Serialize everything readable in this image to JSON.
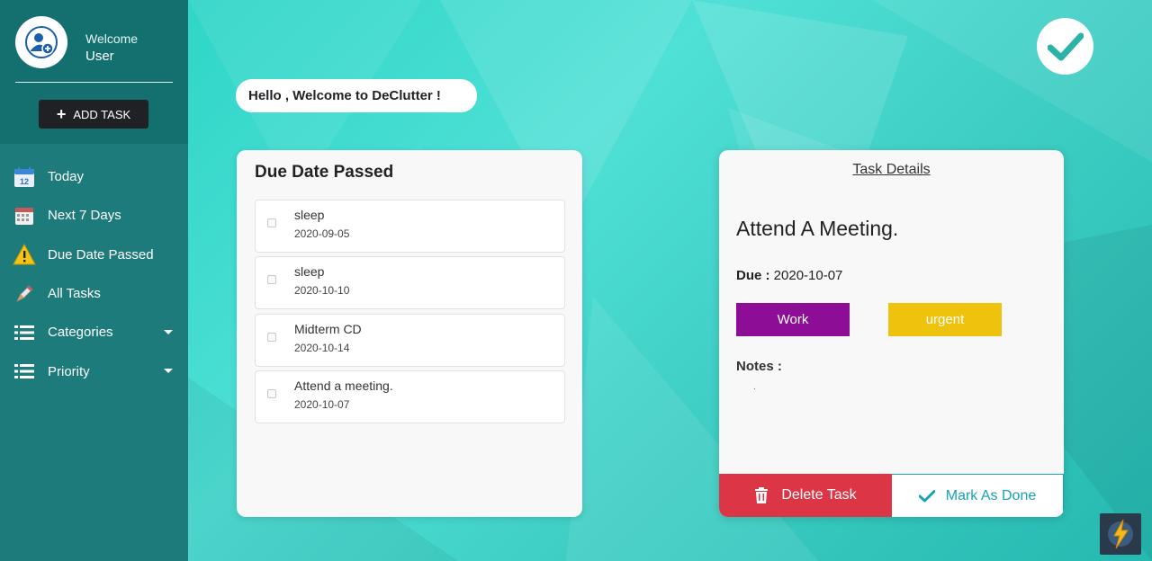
{
  "user": {
    "welcome": "Welcome",
    "name": "User",
    "avatar_icon": "user-plus-icon"
  },
  "sidebar": {
    "add_task_label": "ADD TASK",
    "items": [
      {
        "label": "Today",
        "icon": "calendar-today-icon"
      },
      {
        "label": "Next 7 Days",
        "icon": "calendar-week-icon"
      },
      {
        "label": "Due Date Passed",
        "icon": "warning-icon"
      },
      {
        "label": "All Tasks",
        "icon": "pen-icon"
      },
      {
        "label": "Categories",
        "icon": "list-icon",
        "dropdown": true
      },
      {
        "label": "Priority",
        "icon": "list-icon",
        "dropdown": true
      }
    ],
    "calendar_number": "12"
  },
  "greeting": "Hello , Welcome to DeClutter !",
  "due_panel": {
    "title": "Due Date Passed",
    "tasks": [
      {
        "name": "sleep",
        "date": "2020-09-05"
      },
      {
        "name": "sleep",
        "date": "2020-10-10"
      },
      {
        "name": "Midterm CD",
        "date": "2020-10-14"
      },
      {
        "name": "Attend a meeting.",
        "date": "2020-10-07"
      }
    ]
  },
  "details": {
    "header": "Task Details",
    "title": "Attend A Meeting.",
    "due_label": "Due :",
    "due_date": "2020-10-07",
    "category": "Work",
    "priority": "urgent",
    "notes_label": "Notes :",
    "notes": ".",
    "delete_label": "Delete Task",
    "done_label": "Mark As Done"
  },
  "colors": {
    "sidebar": "#1d7b7b",
    "work_tag": "#8e0d96",
    "urgent_tag": "#efc30d",
    "delete": "#dc3545",
    "done": "#17a2b8",
    "brand_check": "#2bb3a8"
  }
}
